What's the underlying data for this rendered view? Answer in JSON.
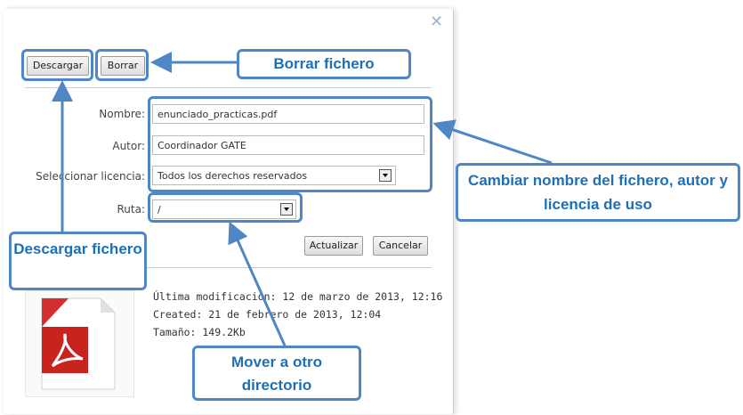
{
  "dialog": {
    "close_icon": "close-icon",
    "buttons": {
      "download": "Descargar",
      "delete": "Borrar",
      "update": "Actualizar",
      "cancel": "Cancelar"
    },
    "form": {
      "name_label": "Nombre:",
      "name_value": "enunciado_practicas.pdf",
      "author_label": "Autor:",
      "author_value": "Coordinador GATE",
      "license_label": "Seleccionar licencia:",
      "license_value": "Todos los derechos reservados",
      "path_label": "Ruta:",
      "path_value": "/"
    },
    "info": {
      "modified": "Última modificación: 12 de marzo de 2013, 12:16",
      "created": "Created: 21 de febrero de 2013, 12:04",
      "size": "Tamaño: 149.2Kb"
    },
    "file_icon": "pdf-icon"
  },
  "annotations": {
    "delete": "Borrar fichero",
    "download": "Descargar fichero",
    "rename": "Cambiar nombre del fichero, autor y licencia de uso",
    "move": "Mover a otro directorio"
  },
  "colors": {
    "annotation_blue": "#4f86c6",
    "annotation_text": "#1f6fb5"
  }
}
